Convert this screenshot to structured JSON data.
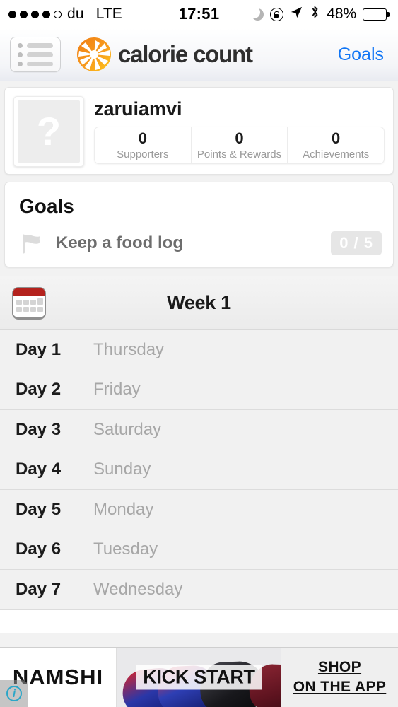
{
  "status_bar": {
    "signal_dots_filled": 4,
    "signal_dots_total": 5,
    "carrier": "du",
    "network": "LTE",
    "time": "17:51",
    "icons": [
      "moon-icon",
      "rotation-lock-icon",
      "location-arrow-icon",
      "bluetooth-icon"
    ],
    "battery_percent": "48%",
    "battery_level": 48
  },
  "header": {
    "menu_label": "menu",
    "brand": "calorie count",
    "goals_link": "Goals",
    "link_color": "#1176f5"
  },
  "profile": {
    "avatar_placeholder": "?",
    "username": "zaruiamvi",
    "stats": [
      {
        "value": "0",
        "label": "Supporters"
      },
      {
        "value": "0",
        "label": "Points & Rewards"
      },
      {
        "value": "0",
        "label": "Achievements"
      }
    ]
  },
  "goals": {
    "title": "Goals",
    "items": [
      {
        "label": "Keep a food log",
        "progress": "0 / 5",
        "icon": "flag-icon"
      }
    ]
  },
  "week": {
    "title": "Week 1",
    "icon": "calendar-icon",
    "days": [
      {
        "number": "Day 1",
        "name": "Thursday"
      },
      {
        "number": "Day 2",
        "name": "Friday"
      },
      {
        "number": "Day 3",
        "name": "Saturday"
      },
      {
        "number": "Day 4",
        "name": "Sunday"
      },
      {
        "number": "Day 5",
        "name": "Monday"
      },
      {
        "number": "Day 6",
        "name": "Tuesday"
      },
      {
        "number": "Day 7",
        "name": "Wednesday"
      }
    ]
  },
  "ad": {
    "brand": "NAMSHI",
    "headline": "KICK START",
    "cta_line1": "SHOP",
    "cta_line2": "ON THE APP",
    "adchoices": "i"
  }
}
